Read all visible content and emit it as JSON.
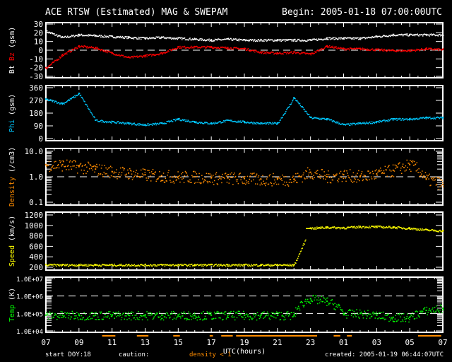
{
  "header": {
    "title": "ACE RTSW (Estimated) MAG & SWEPAM",
    "begin": "Begin: 2005-01-18 07:00:00UTC"
  },
  "footer": {
    "start_doy_label": "start DOY:",
    "start_doy": "18",
    "caution_label": "caution:",
    "caution_text": "density < 1",
    "created": "created: 2005-01-19 06:44:07UTC"
  },
  "colors": {
    "bt": "#ffffff",
    "bz": "#ff0000",
    "phi": "#00c8ff",
    "density": "#ff8c00",
    "speed": "#ffff00",
    "temp": "#00ff00",
    "caution": "#ff8c00"
  },
  "chart_data": {
    "type": "scatter",
    "xlabel": "UTC(hours)",
    "x_ticks": [
      "07",
      "09",
      "11",
      "13",
      "15",
      "17",
      "19",
      "21",
      "23",
      "01",
      "03",
      "05",
      "07"
    ],
    "x_hours": [
      0,
      1,
      2,
      3,
      4,
      5,
      6,
      7,
      8,
      9,
      10,
      11,
      12,
      13,
      14,
      15,
      16,
      17,
      18,
      19,
      20,
      21,
      22,
      23,
      24
    ],
    "panels": [
      {
        "id": "mag",
        "ylabel_parts": [
          "Bt",
          "Bz",
          "(gsm)"
        ],
        "ylim": [
          -30,
          30
        ],
        "scale": "linear",
        "ticks": [
          "30",
          "20",
          "10",
          "0",
          "-10",
          "-20",
          "-30"
        ],
        "tick_values": [
          30,
          20,
          10,
          0,
          -10,
          -20,
          -30
        ],
        "ref_lines": [
          0
        ],
        "series": [
          {
            "name": "Bt",
            "color": "#ffffff",
            "values": [
              22,
              15,
              18,
              17,
              16,
              15,
              14,
              15,
              14,
              13,
              12,
              13,
              12,
              12,
              12,
              12,
              12,
              14,
              14,
              14,
              16,
              18,
              18,
              18,
              18
            ]
          },
          {
            "name": "Bz",
            "color": "#ff0000",
            "values": [
              -20,
              -5,
              5,
              3,
              -3,
              -8,
              -6,
              -3,
              4,
              4,
              4,
              3,
              2,
              -2,
              -3,
              -2,
              -4,
              5,
              2,
              2,
              1,
              0,
              0,
              2,
              1
            ]
          }
        ]
      },
      {
        "id": "phi",
        "ylabel_parts": [
          "Phi",
          "(gsm)"
        ],
        "ylim": [
          0,
          360
        ],
        "scale": "linear",
        "ticks": [
          "360",
          "270",
          "180",
          "90",
          "0"
        ],
        "tick_values": [
          360,
          270,
          180,
          90,
          0
        ],
        "ref_lines": [],
        "series": [
          {
            "name": "Phi",
            "color": "#00c8ff",
            "values": [
              280,
              250,
              320,
              130,
              120,
              110,
              100,
              110,
              140,
              120,
              110,
              130,
              120,
              110,
              110,
              290,
              150,
              140,
              100,
              110,
              120,
              140,
              140,
              150,
              150
            ]
          }
        ]
      },
      {
        "id": "density",
        "ylabel_parts": [
          "Density",
          "(/cm3)"
        ],
        "ylim": [
          0.1,
          10
        ],
        "scale": "log",
        "ticks": [
          "10.0",
          "1.0",
          "0.1"
        ],
        "tick_values": [
          10,
          1,
          0.1
        ],
        "ref_lines": [
          1
        ],
        "series": [
          {
            "name": "Density",
            "color": "#ff8c00",
            "values": [
              3,
              3,
              2.5,
              2,
              1.6,
              1.4,
              1.2,
              1.1,
              1.0,
              1.0,
              0.9,
              0.9,
              0.85,
              0.8,
              0.8,
              0.8,
              1.5,
              1.0,
              1.2,
              1.0,
              1.3,
              1.8,
              3,
              0.8,
              0.5
            ]
          }
        ]
      },
      {
        "id": "speed",
        "ylabel_parts": [
          "Speed",
          "(km/s)"
        ],
        "ylim": [
          200,
          1200
        ],
        "scale": "linear",
        "ticks": [
          "1200",
          "1000",
          "800",
          "600",
          "400",
          "200"
        ],
        "tick_values": [
          1200,
          1000,
          800,
          600,
          400,
          200
        ],
        "ref_lines": [],
        "series": [
          {
            "name": "Speed",
            "color": "#ffff00",
            "values": [
              250,
              250,
              250,
              250,
              250,
              250,
              250,
              250,
              250,
              250,
              250,
              250,
              250,
              250,
              250,
              250,
              950,
              970,
              960,
              980,
              980,
              970,
              950,
              920,
              900
            ]
          }
        ]
      },
      {
        "id": "temp",
        "ylabel_parts": [
          "Temp",
          "(K)"
        ],
        "ylim": [
          10000,
          10000000
        ],
        "scale": "log",
        "ticks": [
          "1.0E+07",
          "1.0E+06",
          "1.0E+05",
          "1.0E+04"
        ],
        "tick_values": [
          10000000,
          1000000,
          100000,
          10000
        ],
        "ref_lines": [
          1000000,
          100000
        ],
        "series": [
          {
            "name": "Temp",
            "color": "#00ff00",
            "values": [
              80000,
              80000,
              80000,
              80000,
              80000,
              80000,
              80000,
              80000,
              80000,
              80000,
              80000,
              80000,
              80000,
              80000,
              80000,
              80000,
              700000,
              500000,
              100000,
              100000,
              80000,
              60000,
              60000,
              150000,
              200000
            ]
          }
        ]
      }
    ],
    "caution_intervals_hours": [
      [
        3.4,
        4.2
      ],
      [
        5.5,
        6.2
      ],
      [
        7.7,
        8.1
      ],
      [
        9.9,
        10.1
      ],
      [
        10.6,
        11.3
      ],
      [
        11.5,
        16.4
      ],
      [
        17.4,
        17.8
      ],
      [
        18.2,
        18.5
      ],
      [
        22.5,
        23.9
      ]
    ]
  }
}
